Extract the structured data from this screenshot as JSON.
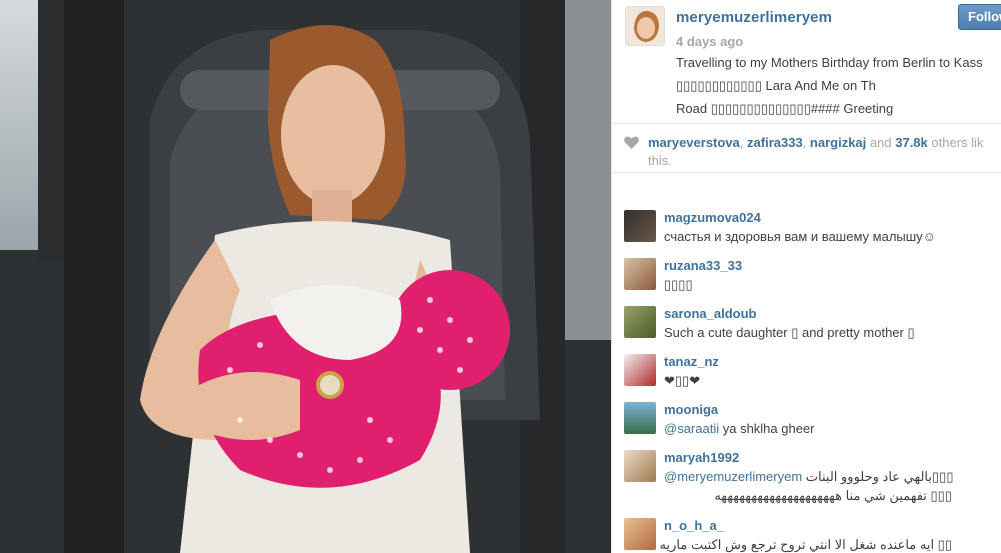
{
  "post": {
    "owner": "meryemuzerlimeryem",
    "time": "4 days ago",
    "follow_label": "Follow",
    "caption_lines": [
      "Travelling to my Mothers Birthday from Berlin to Kass",
      "▯▯▯▯▯▯▯▯▯▯▯▯ Lara And Me on Th",
      "Road ▯▯▯▯▯▯▯▯▯▯▯▯▯▯#### Greeting"
    ]
  },
  "likes": {
    "users": [
      "maryeverstova",
      "zafira333",
      "nargizkaj"
    ],
    "and": "and",
    "count": "37.8k",
    "others": "others lik",
    "line2": "this."
  },
  "comments": [
    {
      "user": "magzumova024",
      "text": "счастья и здоровья вам и вашему малышу☺"
    },
    {
      "user": "ruzana33_33",
      "text": "▯▯▯▯"
    },
    {
      "user": "sarona_aldoub",
      "text": "Such a cute daughter ▯ and pretty mother ▯"
    },
    {
      "user": "tanaz_nz",
      "text": "❤▯▯❤"
    },
    {
      "user": "mooniga",
      "mention": "@saraatii",
      "text": " ya shklha gheer"
    },
    {
      "user": "maryah1992",
      "mention": "@meryemuzerlimeryem",
      "text": "▯▯▯بالهي عاد وحلووو البنات",
      "text2": "▯▯▯ تفهمين شي منا ههههههههههههههههههههه"
    },
    {
      "user": "n_o_h_a_",
      "text": "▯▯ ايه ماعنده شغل الا انتي تروح ترجع وش اكتبت ماريه"
    }
  ],
  "colors": {
    "link": "#3f729b",
    "muted": "#a5a7aa",
    "text": "#3f3f3f",
    "follow": "#5b87b7",
    "dress_pink": "#e0206e"
  },
  "icons": {
    "heart": "heart-icon"
  }
}
